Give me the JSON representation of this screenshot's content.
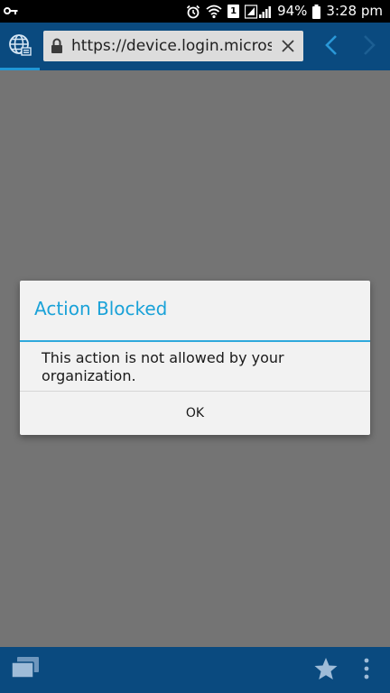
{
  "status_bar": {
    "battery_percent": "94%",
    "time": "3:28 pm",
    "sim_badge": "1",
    "icons": [
      "key-icon",
      "alarm-icon",
      "wifi-icon",
      "sim-icon",
      "signal-icon",
      "battery-icon"
    ]
  },
  "browser": {
    "url": "https://device.login.microsof",
    "icons": [
      "globe-icon",
      "lock-icon",
      "clear-icon",
      "back-icon",
      "forward-icon"
    ]
  },
  "dialog": {
    "title": "Action Blocked",
    "message": "This action is not allowed by your organization.",
    "ok_label": "OK"
  },
  "bottom_bar": {
    "icons": [
      "tabs-icon",
      "star-icon",
      "overflow-menu-icon"
    ]
  },
  "colors": {
    "bar_blue": "#0a4a7f",
    "accent": "#1aa2d8",
    "overlay": "#747474"
  }
}
